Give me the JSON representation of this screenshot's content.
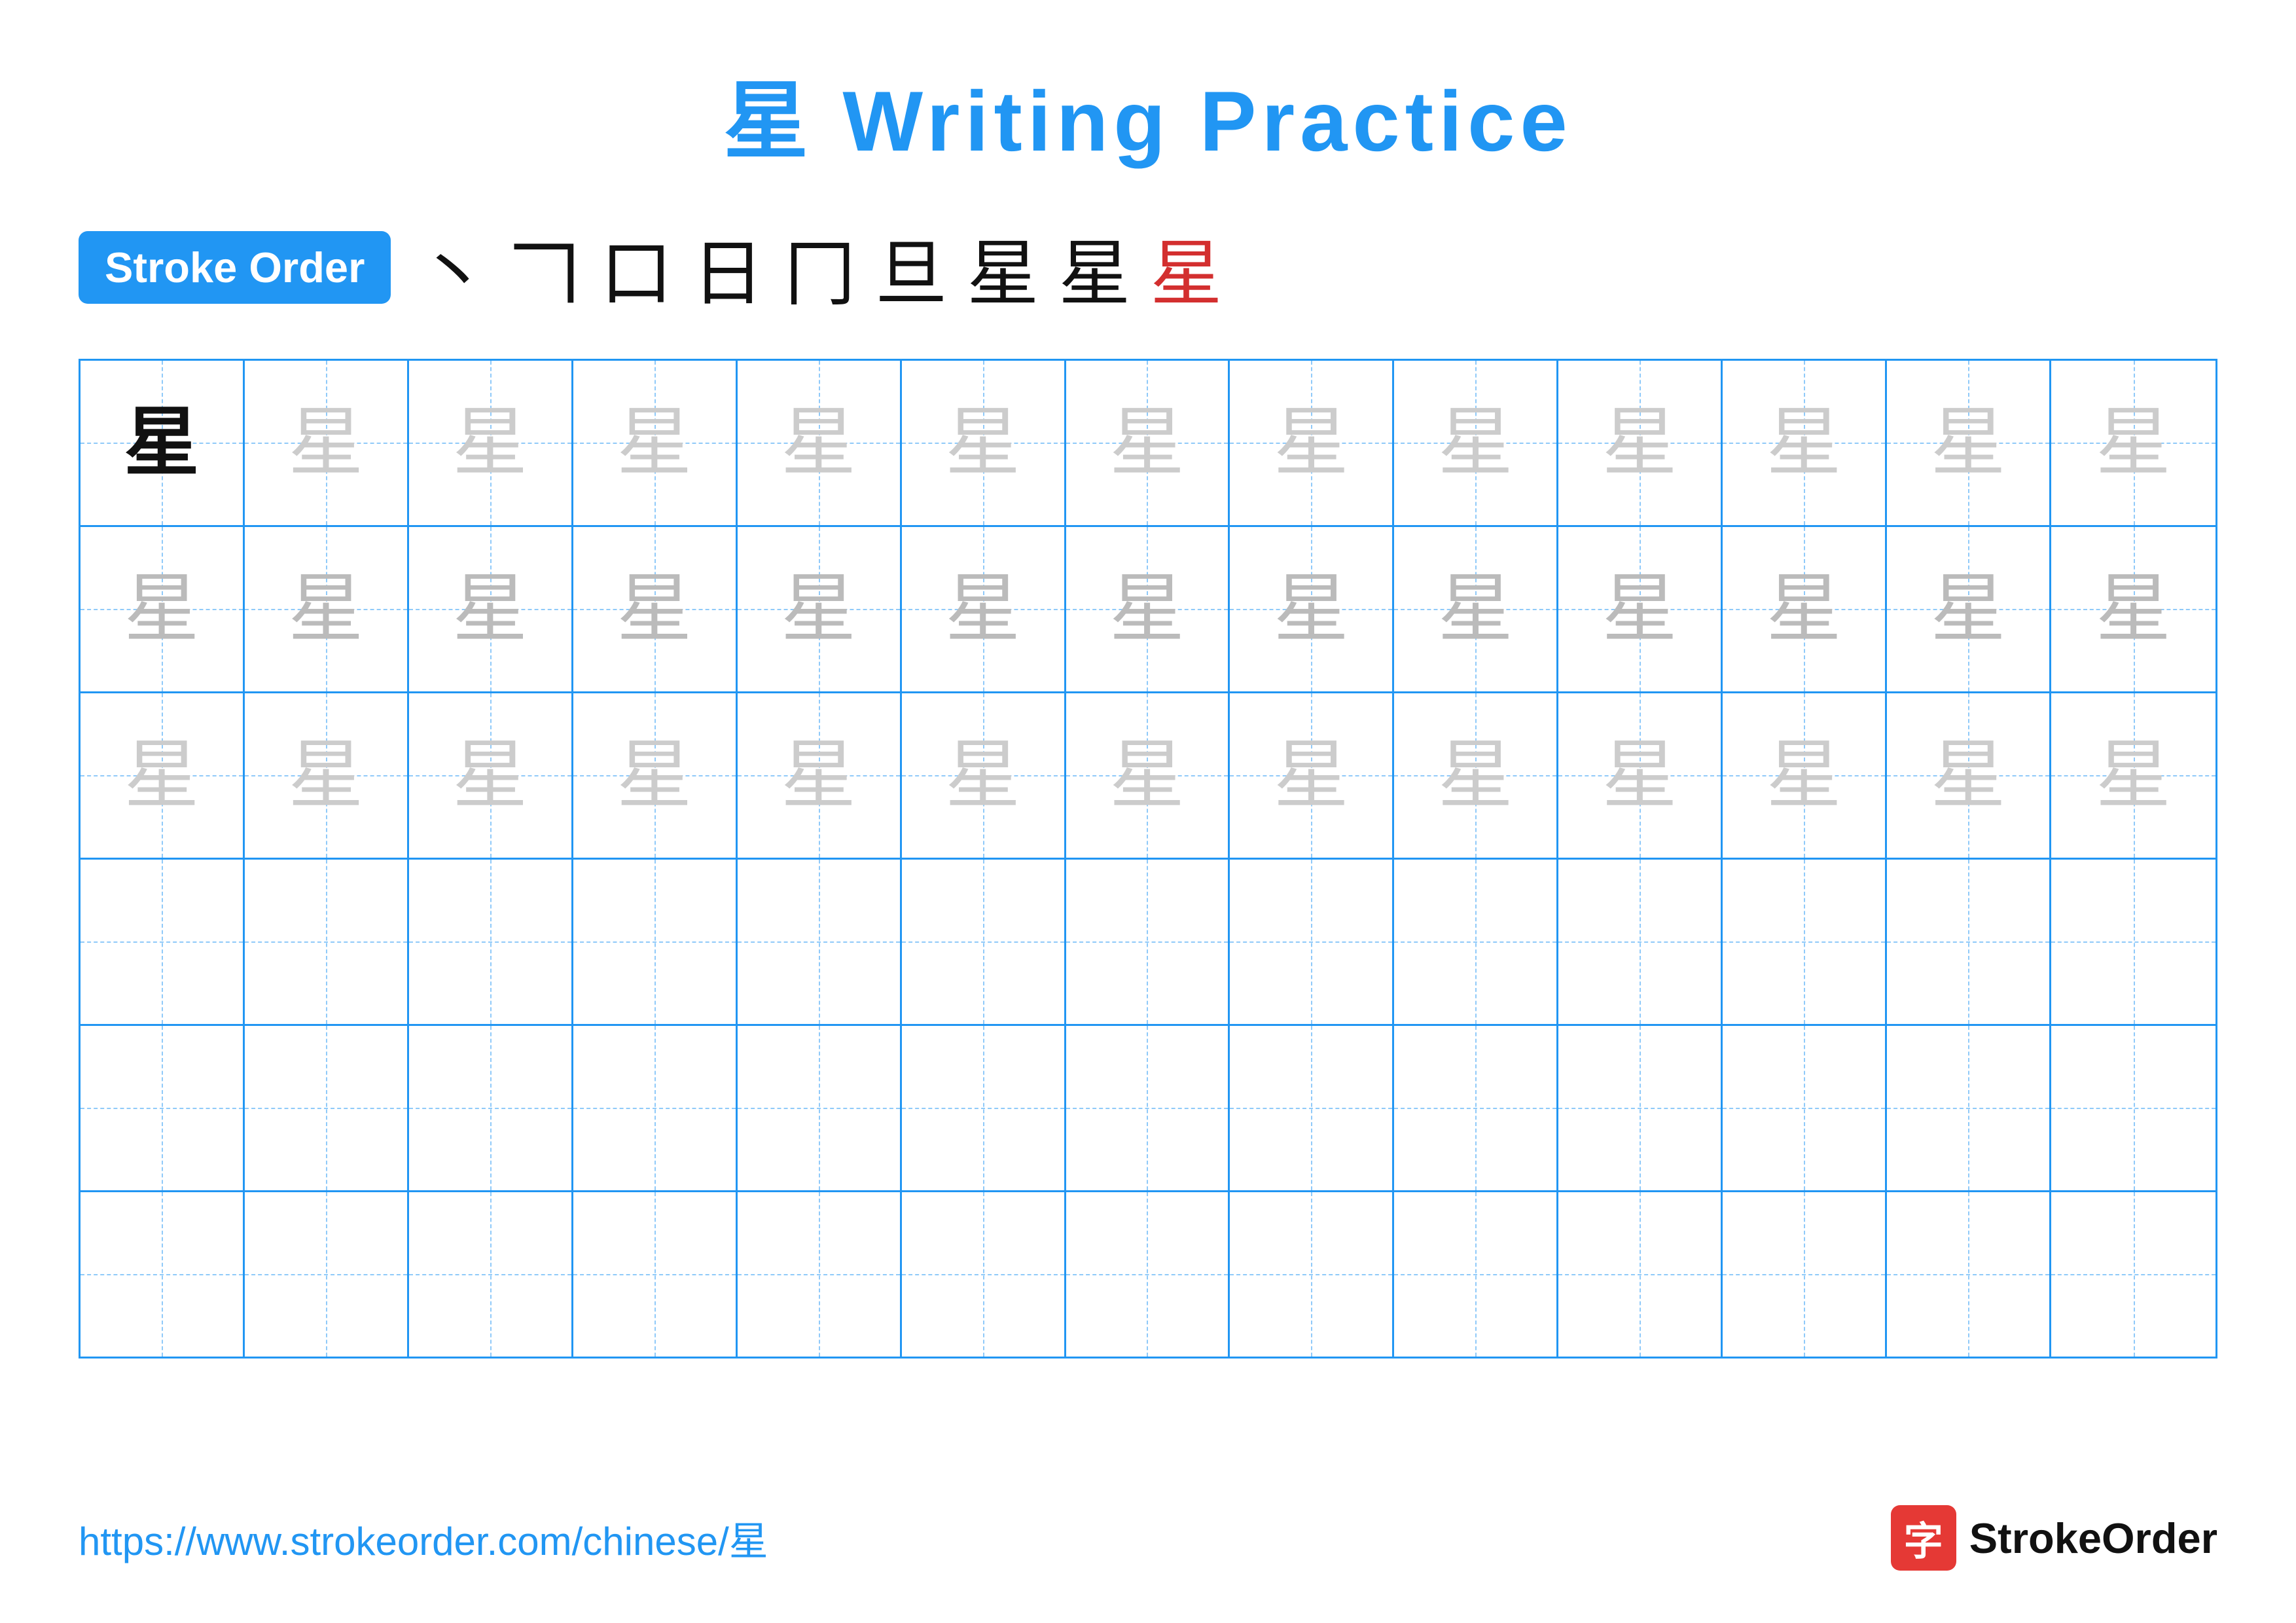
{
  "title": "星 Writing Practice",
  "stroke_order_badge": "Stroke Order",
  "stroke_sequence": [
    "丶",
    "𠃍",
    "口",
    "日",
    "⺕",
    "旦",
    "星",
    "星",
    "星"
  ],
  "stroke_sequence_colors": [
    "black",
    "black",
    "black",
    "black",
    "black",
    "black",
    "black",
    "black",
    "red"
  ],
  "character": "星",
  "grid_rows": 6,
  "grid_cols": 13,
  "row_styles": [
    "dark_first_light_rest",
    "light",
    "medium",
    "empty",
    "empty",
    "empty"
  ],
  "footer_url": "https://www.strokeorder.com/chinese/星",
  "footer_logo_char": "字",
  "footer_logo_brand": "StrokeOrder"
}
